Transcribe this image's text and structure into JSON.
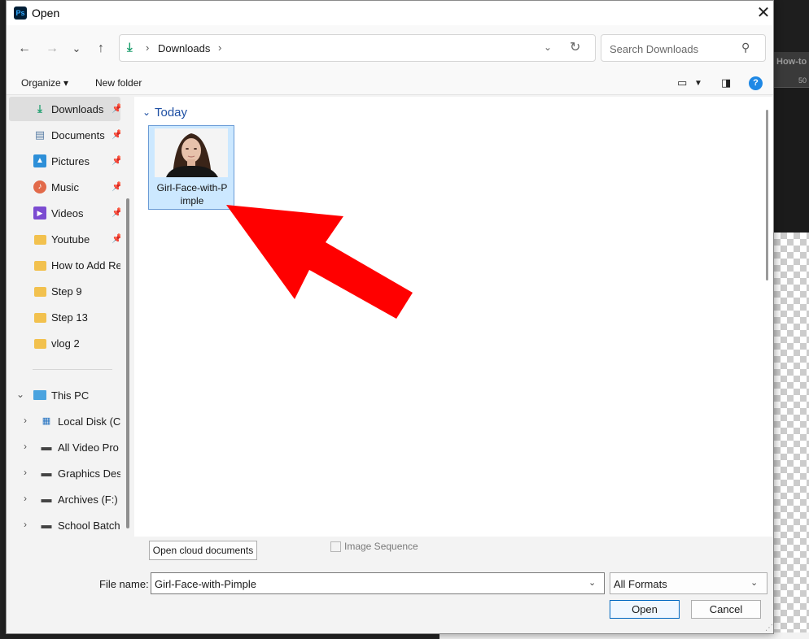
{
  "background": {
    "tab_label": "How-to",
    "ruler_label": "50"
  },
  "dialog": {
    "title": "Open",
    "app_icon_text": "Ps"
  },
  "nav": {
    "back": "←",
    "forward": "→",
    "recent": "⌄",
    "up": "↑",
    "address_path": "Downloads",
    "search_placeholder": "Search Downloads"
  },
  "commands": {
    "organize": "Organize ▾",
    "new_folder": "New folder"
  },
  "sidebar": {
    "items": [
      {
        "label": "Downloads",
        "icon": "download-icon",
        "pinned": true,
        "selected": true
      },
      {
        "label": "Documents",
        "icon": "document-icon",
        "pinned": true
      },
      {
        "label": "Pictures",
        "icon": "pictures-icon",
        "pinned": true
      },
      {
        "label": "Music",
        "icon": "music-icon",
        "pinned": true
      },
      {
        "label": "Videos",
        "icon": "videos-icon",
        "pinned": true
      },
      {
        "label": "Youtube",
        "icon": "folder-icon",
        "pinned": true
      },
      {
        "label": "How to Add Re",
        "icon": "folder-icon"
      },
      {
        "label": "Step 9",
        "icon": "folder-icon"
      },
      {
        "label": "Step 13",
        "icon": "folder-icon"
      },
      {
        "label": "vlog 2",
        "icon": "folder-icon"
      }
    ],
    "this_pc": "This PC",
    "drives": [
      {
        "label": "Local Disk (C:"
      },
      {
        "label": "All Video Pro"
      },
      {
        "label": "Graphics Des"
      },
      {
        "label": "Archives (F:)"
      },
      {
        "label": "School Batch"
      }
    ]
  },
  "content": {
    "group_label": "Today",
    "file": {
      "name_line1": "Girl-Face-with-P",
      "name_line2": "imple"
    }
  },
  "bottom": {
    "cloud_button": "Open cloud documents",
    "image_sequence_label": "Image Sequence",
    "image_sequence_checked": false,
    "file_name_label": "File name:",
    "file_name_value": "Girl-Face-with-Pimple",
    "format_value": "All Formats",
    "open_button": "Open",
    "cancel_button": "Cancel"
  },
  "colors": {
    "arrow": "#ff0000",
    "selection": "#cce8ff",
    "accent": "#0067c0"
  }
}
